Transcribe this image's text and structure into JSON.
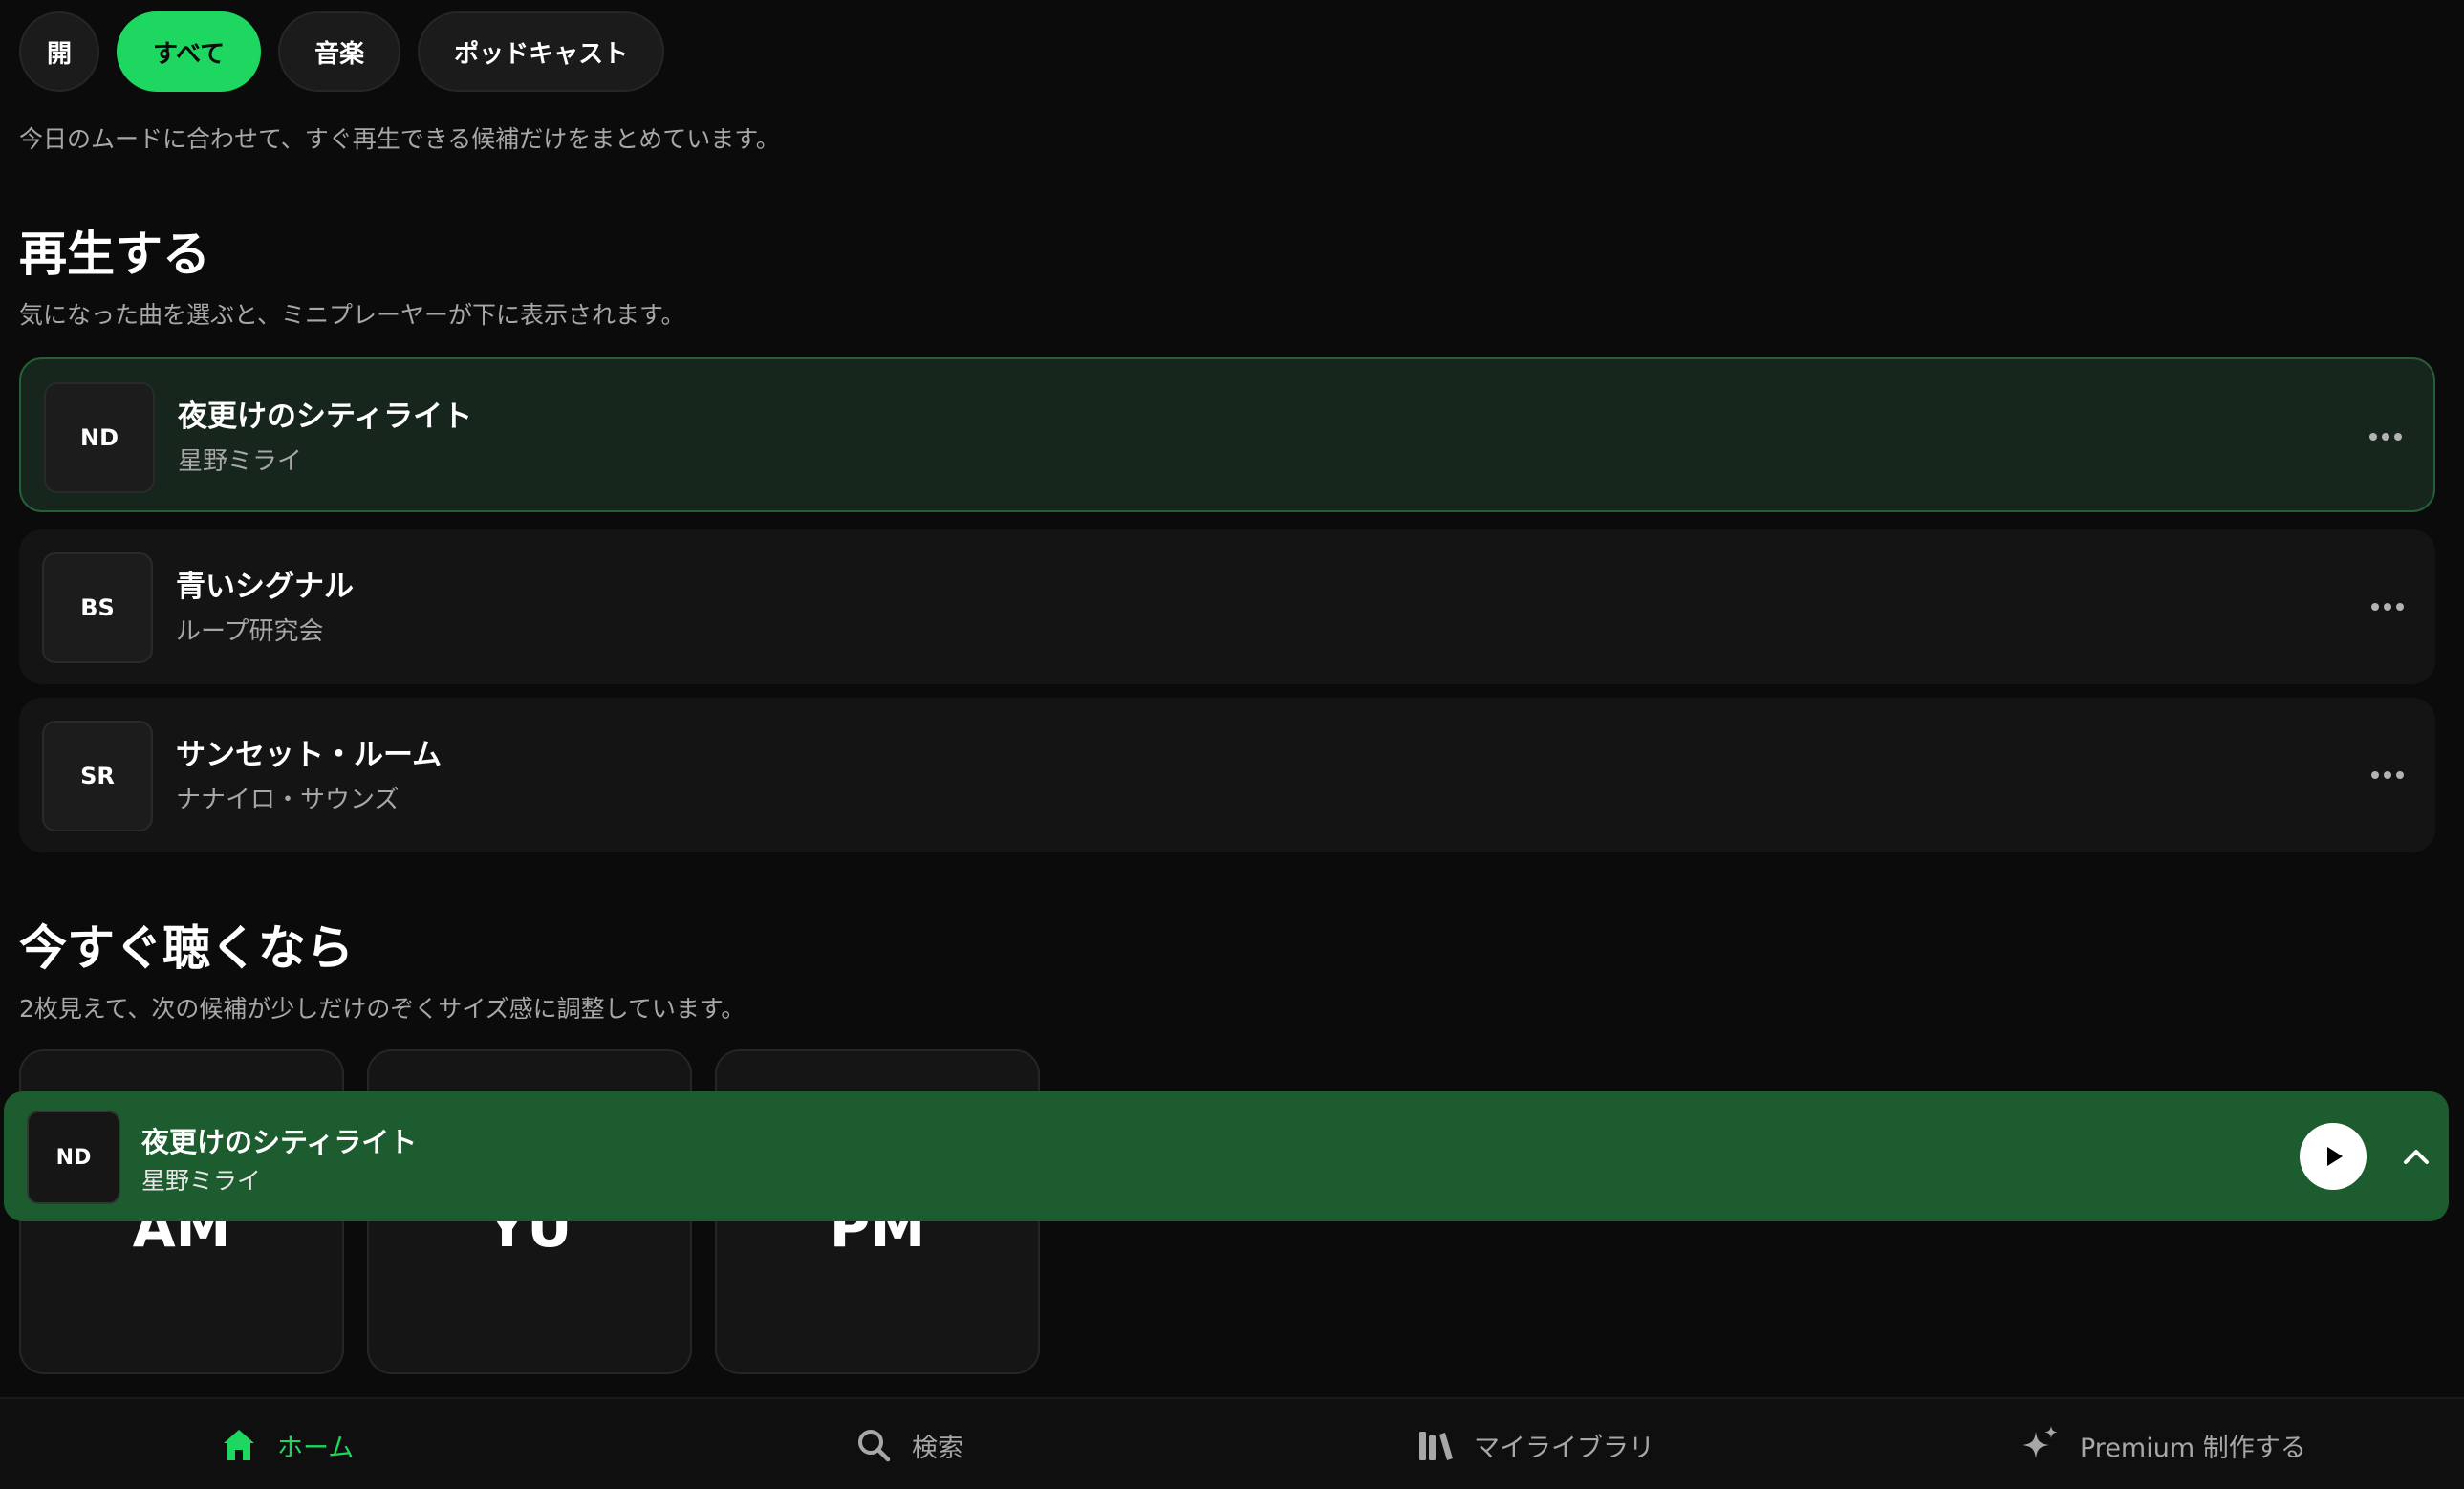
{
  "filters": {
    "items": [
      {
        "label": "開",
        "active": false
      },
      {
        "label": "すべて",
        "active": true
      },
      {
        "label": "音楽",
        "active": false
      },
      {
        "label": "ポッドキャスト",
        "active": false
      }
    ]
  },
  "intro_text": "今日のムードに合わせて、すぐ再生できる候補だけをまとめています。",
  "play_section": {
    "title": "再生する",
    "subtitle": "気になった曲を選ぶと、ミニプレーヤーが下に表示されます。",
    "tracks": [
      {
        "initials": "ND",
        "title": "夜更けのシティライト",
        "artist": "星野ミライ",
        "selected": true
      },
      {
        "initials": "BS",
        "title": "青いシグナル",
        "artist": "ループ研究会",
        "selected": false
      },
      {
        "initials": "SR",
        "title": "サンセット・ルーム",
        "artist": "ナナイロ・サウンズ",
        "selected": false
      }
    ]
  },
  "listen_section": {
    "title": "今すぐ聴くなら",
    "subtitle": "2枚見えて、次の候補が少しだけのぞくサイズ感に調整しています。",
    "cards": [
      {
        "label": "AM"
      },
      {
        "label": "YU"
      },
      {
        "label": "PM"
      }
    ]
  },
  "mini_player": {
    "initials": "ND",
    "title": "夜更けのシティライト",
    "artist": "星野ミライ",
    "play_icon": "play-icon",
    "expand_icon": "chevron-up-icon"
  },
  "bottom_nav": {
    "items": [
      {
        "label": "ホーム",
        "icon": "home-icon",
        "active": true
      },
      {
        "label": "検索",
        "icon": "search-icon",
        "active": false
      },
      {
        "label": "マイライブラリ",
        "icon": "library-icon",
        "active": false
      },
      {
        "label": "Premium 制作する",
        "icon": "sparkle-icon",
        "active": false
      }
    ]
  },
  "colors": {
    "accent": "#1ed760",
    "background": "#0b0b0b",
    "mini_player_bg": "#1d5c2e",
    "selected_row_bg": "#17261d"
  }
}
